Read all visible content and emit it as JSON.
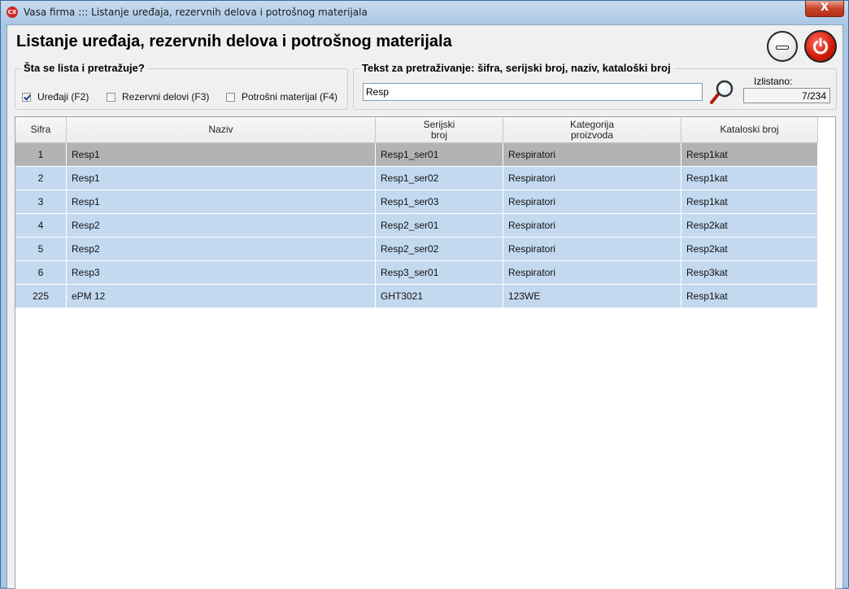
{
  "window": {
    "app_icon_text": "CX",
    "title": "Vasa firma ::: Listanje uređaja, rezervnih delova i potrošnog materijala",
    "close_symbol": "X"
  },
  "page": {
    "title": "Listanje uređaja, rezervnih delova i potrošnog materijala"
  },
  "toolbar": {
    "minimize_icon": "minimize-icon",
    "power_icon": "power-icon",
    "power_color": "#d01a0a"
  },
  "filter_group": {
    "label": "Šta se lista i pretražuje?",
    "options": [
      {
        "label": "Uređaji (F2)",
        "checked": true
      },
      {
        "label": "Rezervni delovi (F3)",
        "checked": false
      },
      {
        "label": "Potrošni materijal (F4)",
        "checked": false
      }
    ]
  },
  "search_group": {
    "label": "Tekst za pretraživanje: šifra, serijski broj, naziv, kataloški broj",
    "value": "Resp",
    "search_icon": "magnifier-icon",
    "count_label": "Izlistano:",
    "count_value": "7/234"
  },
  "grid": {
    "columns": [
      "Sifra",
      "Naziv",
      "Serijski\nbroj",
      "Kategorija\nproizvoda",
      "Kataloski broj"
    ],
    "rows": [
      {
        "sifra": "1",
        "naziv": "Resp1",
        "serijski": "Resp1_ser01",
        "kategorija": "Respiratori",
        "katalog": "Resp1kat",
        "selected": true
      },
      {
        "sifra": "2",
        "naziv": "Resp1",
        "serijski": "Resp1_ser02",
        "kategorija": "Respiratori",
        "katalog": "Resp1kat",
        "selected": false
      },
      {
        "sifra": "3",
        "naziv": "Resp1",
        "serijski": "Resp1_ser03",
        "kategorija": "Respiratori",
        "katalog": "Resp1kat",
        "selected": false
      },
      {
        "sifra": "4",
        "naziv": "Resp2",
        "serijski": "Resp2_ser01",
        "kategorija": "Respiratori",
        "katalog": "Resp2kat",
        "selected": false
      },
      {
        "sifra": "5",
        "naziv": "Resp2",
        "serijski": "Resp2_ser02",
        "kategorija": "Respiratori",
        "katalog": "Resp2kat",
        "selected": false
      },
      {
        "sifra": "6",
        "naziv": "Resp3",
        "serijski": "Resp3_ser01",
        "kategorija": "Respiratori",
        "katalog": "Resp3kat",
        "selected": false
      },
      {
        "sifra": "225",
        "naziv": "ePM 12",
        "serijski": "GHT3021",
        "kategorija": "123WE",
        "katalog": "Resp1kat",
        "selected": false
      }
    ],
    "selected_color": "#b3b3b3",
    "row_color": "#c3d9f0"
  }
}
